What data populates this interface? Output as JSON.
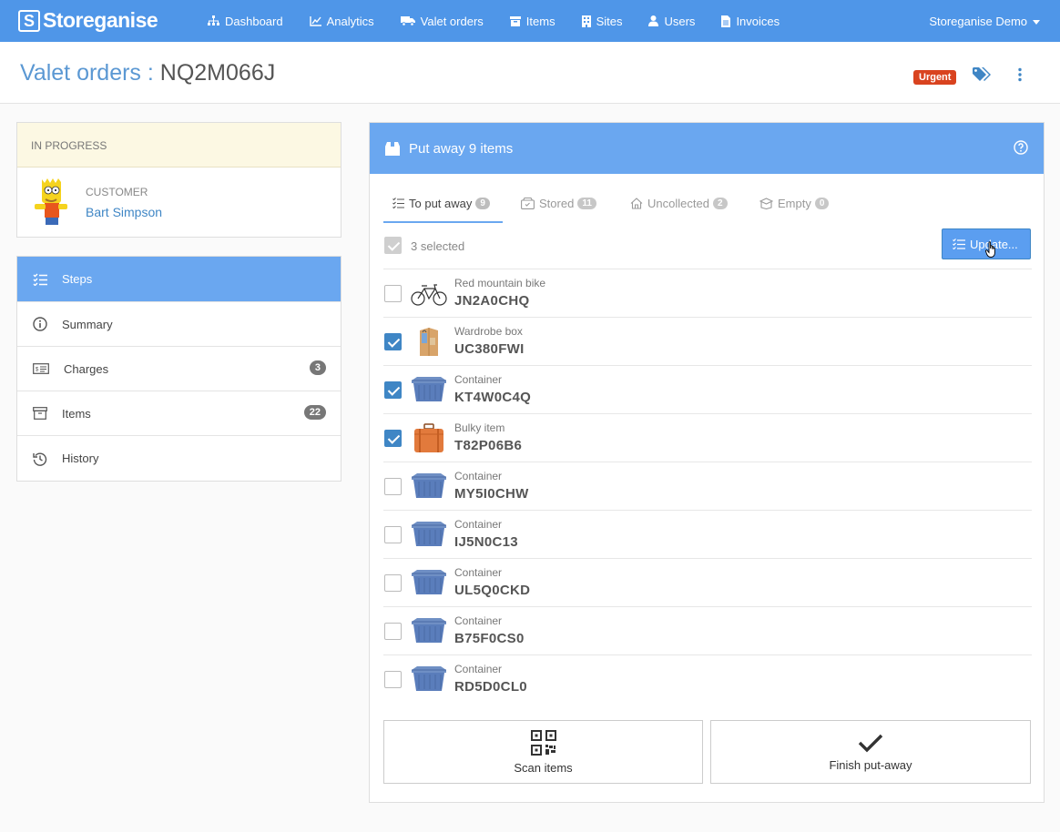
{
  "nav": {
    "brand": "Storeganise",
    "items": [
      {
        "label": "Dashboard",
        "icon": "sitemap-icon"
      },
      {
        "label": "Analytics",
        "icon": "chart-icon"
      },
      {
        "label": "Valet orders",
        "icon": "truck-icon"
      },
      {
        "label": "Items",
        "icon": "archive-icon"
      },
      {
        "label": "Sites",
        "icon": "building-icon"
      },
      {
        "label": "Users",
        "icon": "user-icon"
      },
      {
        "label": "Invoices",
        "icon": "file-icon"
      }
    ],
    "account": "Storeganise Demo"
  },
  "header": {
    "crumb": "Valet orders :",
    "ref": "NQ2M066J",
    "badge": "Urgent"
  },
  "status": {
    "label": "IN PROGRESS",
    "customer_label": "CUSTOMER",
    "customer_name": "Bart Simpson"
  },
  "sidebar": {
    "items": [
      {
        "label": "Steps",
        "icon": "list-check-icon",
        "active": true
      },
      {
        "label": "Summary",
        "icon": "info-icon"
      },
      {
        "label": "Charges",
        "icon": "money-icon",
        "count": "3"
      },
      {
        "label": "Items",
        "icon": "archive-icon",
        "count": "22"
      },
      {
        "label": "History",
        "icon": "history-icon"
      }
    ]
  },
  "panel": {
    "title": "Put away 9 items",
    "tabs": [
      {
        "label": "To put away",
        "count": "9",
        "active": true
      },
      {
        "label": "Stored",
        "count": "11"
      },
      {
        "label": "Uncollected",
        "count": "2"
      },
      {
        "label": "Empty",
        "count": "0"
      }
    ],
    "selected_label": "3 selected",
    "update_label": "Update...",
    "items": [
      {
        "type": "Red mountain bike",
        "code": "JN2A0CHQ",
        "checked": false,
        "thumb": "bike"
      },
      {
        "type": "Wardrobe box",
        "code": "UC380FWI",
        "checked": true,
        "thumb": "wardrobe"
      },
      {
        "type": "Container",
        "code": "KT4W0C4Q",
        "checked": true,
        "thumb": "container"
      },
      {
        "type": "Bulky item",
        "code": "T82P06B6",
        "checked": true,
        "thumb": "suitcase"
      },
      {
        "type": "Container",
        "code": "MY5I0CHW",
        "checked": false,
        "thumb": "container"
      },
      {
        "type": "Container",
        "code": "IJ5N0C13",
        "checked": false,
        "thumb": "container"
      },
      {
        "type": "Container",
        "code": "UL5Q0CKD",
        "checked": false,
        "thumb": "container"
      },
      {
        "type": "Container",
        "code": "B75F0CS0",
        "checked": false,
        "thumb": "container"
      },
      {
        "type": "Container",
        "code": "RD5D0CL0",
        "checked": false,
        "thumb": "container"
      }
    ],
    "scan_label": "Scan items",
    "finish_label": "Finish put-away"
  },
  "colors": {
    "primary": "#4f96e8",
    "panel_head": "#6aa7f0",
    "urgent": "#d9431f",
    "checked": "#3f86c5"
  }
}
